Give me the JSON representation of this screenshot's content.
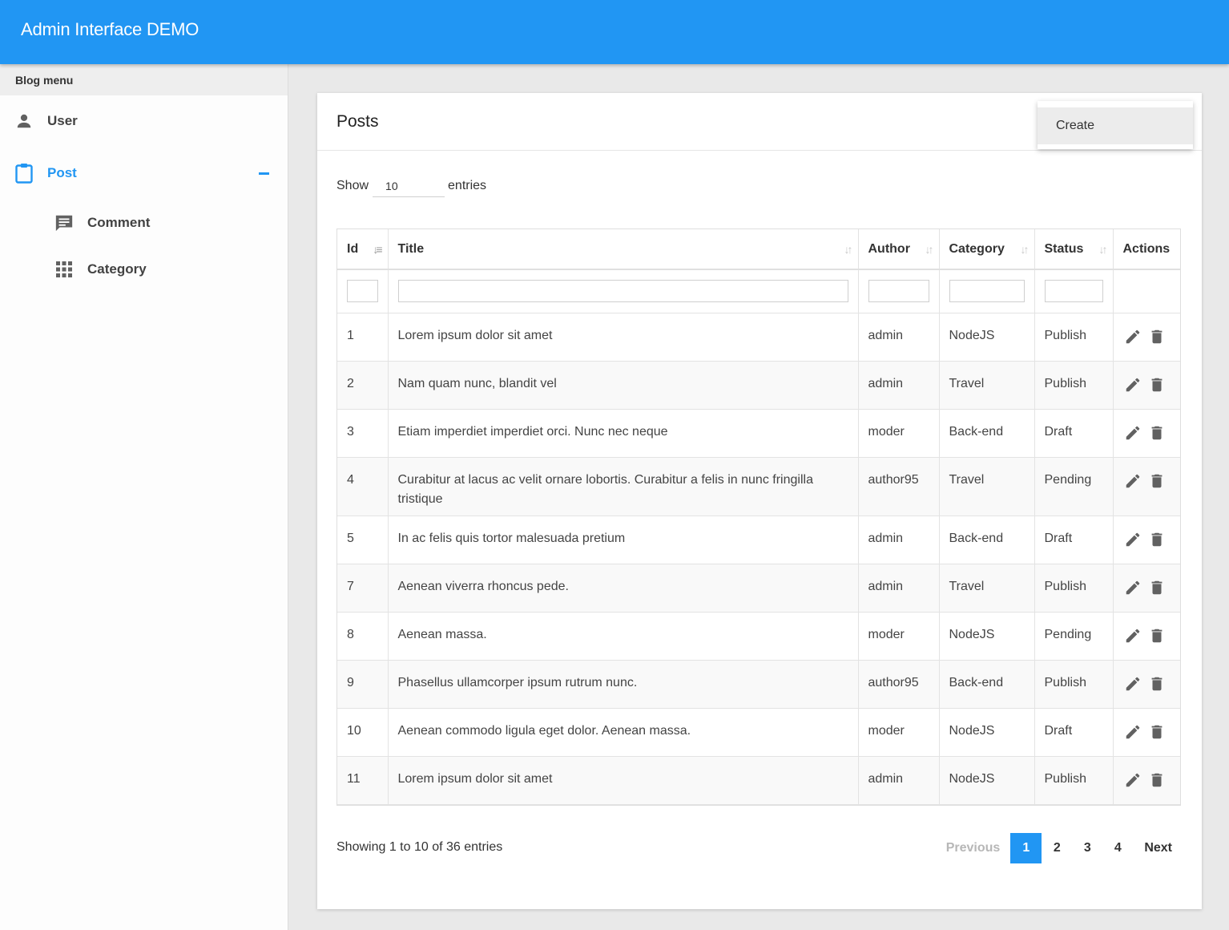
{
  "app": {
    "title": "Admin Interface DEMO"
  },
  "sidebar": {
    "header": "Blog menu",
    "items": [
      {
        "label": "User",
        "icon": "person-icon"
      },
      {
        "label": "Post",
        "icon": "clipboard-icon",
        "active": true
      },
      {
        "label": "Comment",
        "icon": "comment-icon"
      },
      {
        "label": "Category",
        "icon": "apps-grid-icon"
      }
    ]
  },
  "card": {
    "title": "Posts",
    "create_label": "Create"
  },
  "length": {
    "show_label": "Show",
    "value": "10",
    "entries_label": "entries"
  },
  "table": {
    "columns": [
      "Id",
      "Title",
      "Author",
      "Category",
      "Status",
      "Actions"
    ],
    "rows": [
      {
        "id": "1",
        "title": "Lorem ipsum dolor sit amet",
        "author": "admin",
        "category": "NodeJS",
        "status": "Publish"
      },
      {
        "id": "2",
        "title": "Nam quam nunc, blandit vel",
        "author": "admin",
        "category": "Travel",
        "status": "Publish"
      },
      {
        "id": "3",
        "title": "Etiam imperdiet imperdiet orci. Nunc nec neque",
        "author": "moder",
        "category": "Back-end",
        "status": "Draft"
      },
      {
        "id": "4",
        "title": "Curabitur at lacus ac velit ornare lobortis. Curabitur a felis in nunc fringilla tristique",
        "author": "author95",
        "category": "Travel",
        "status": "Pending"
      },
      {
        "id": "5",
        "title": "In ac felis quis tortor malesuada pretium",
        "author": "admin",
        "category": "Back-end",
        "status": "Draft"
      },
      {
        "id": "7",
        "title": "Aenean viverra rhoncus pede.",
        "author": "admin",
        "category": "Travel",
        "status": "Publish"
      },
      {
        "id": "8",
        "title": "Aenean massa.",
        "author": "moder",
        "category": "NodeJS",
        "status": "Pending"
      },
      {
        "id": "9",
        "title": "Phasellus ullamcorper ipsum rutrum nunc.",
        "author": "author95",
        "category": "Back-end",
        "status": "Publish"
      },
      {
        "id": "10",
        "title": "Aenean commodo ligula eget dolor. Aenean massa.",
        "author": "moder",
        "category": "NodeJS",
        "status": "Draft"
      },
      {
        "id": "11",
        "title": "Lorem ipsum dolor sit amet",
        "author": "admin",
        "category": "NodeJS",
        "status": "Publish"
      }
    ]
  },
  "footer": {
    "info": "Showing 1 to 10 of 36 entries",
    "previous": "Previous",
    "pages": [
      "1",
      "2",
      "3",
      "4"
    ],
    "current_page": "1",
    "next": "Next"
  },
  "colors": {
    "accent": "#2196f3",
    "icon": "#616161"
  }
}
